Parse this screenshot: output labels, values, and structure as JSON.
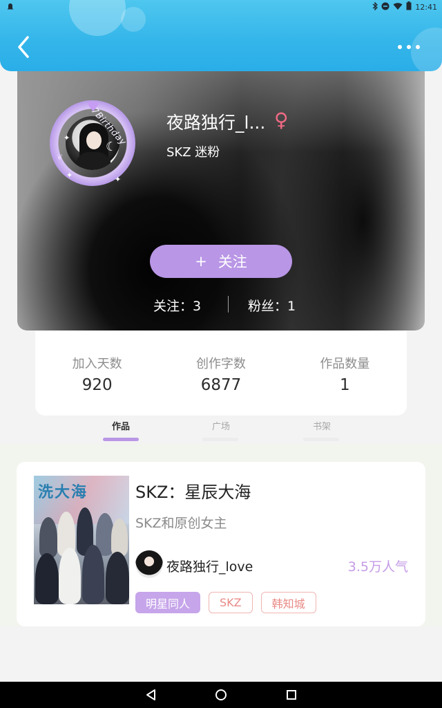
{
  "status_bar": {
    "time": "12:41",
    "icons": [
      "notification-icon",
      "bluetooth-icon",
      "do-not-disturb-icon",
      "wifi-icon",
      "battery-icon"
    ]
  },
  "header": {
    "back_icon": "chevron-left-icon",
    "more_icon": "more-dots-icon"
  },
  "profile": {
    "nickname": "夜路独行_l...",
    "gender_symbol": "♀",
    "fan_label": "SKZ 迷粉",
    "frame_text": "7Birthday",
    "follow_plus": "+",
    "follow_label": "关注",
    "following": "关注：3",
    "fans": "粉丝：1"
  },
  "stats": [
    {
      "label": "加入天数",
      "value": "920"
    },
    {
      "label": "创作字数",
      "value": "6877"
    },
    {
      "label": "作品数量",
      "value": "1"
    }
  ],
  "tabs": [
    {
      "label": "作品",
      "active": true
    },
    {
      "label": "广场",
      "active": false
    },
    {
      "label": "书架",
      "active": false
    }
  ],
  "work": {
    "title": "SKZ：星辰大海",
    "description": "SKZ和原创女主",
    "author": "夜路独行_love",
    "popularity": "3.5万人气",
    "tags": [
      "明星同人",
      "SKZ",
      "韩知城"
    ]
  },
  "colors": {
    "header_blue": "#35b6ea",
    "accent_purple": "#b996e6",
    "tag_outline": "#efb4b0",
    "gender_pink": "#f06a84"
  },
  "navbar": {
    "icons": [
      "back-triangle-icon",
      "home-circle-icon",
      "recents-square-icon"
    ]
  }
}
